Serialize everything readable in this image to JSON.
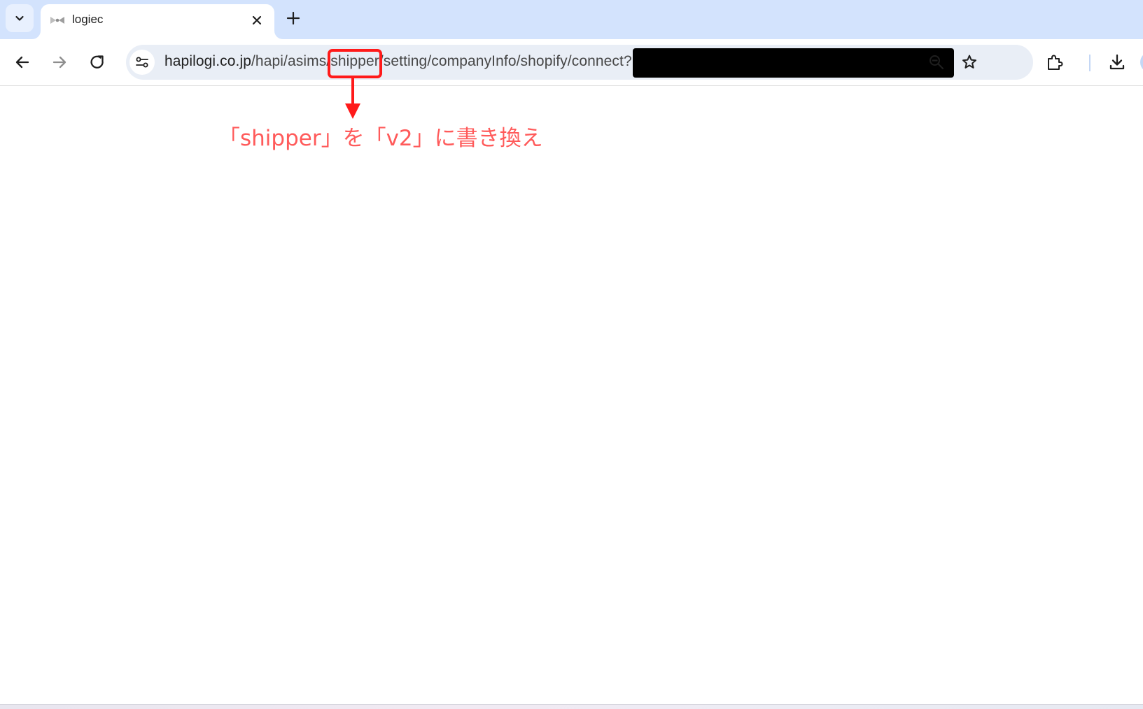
{
  "window": {
    "tab": {
      "title": "logiec",
      "icons": {
        "favicon": "bow-tie-favicon",
        "close": "close-icon"
      }
    },
    "tab_search_icon": "chevron-down-icon",
    "new_tab_icon": "plus-icon"
  },
  "toolbar": {
    "icons": [
      "back-arrow-icon",
      "forward-arrow-icon",
      "reload-icon",
      "zoom-out-icon",
      "star-icon",
      "extensions-icon",
      "download-icon"
    ],
    "url": {
      "host": "hapilogi.co.jp",
      "path_before": "/hapi/asims/",
      "highlighted_segment": "shipper",
      "path_after": "/setting/companyInfo/shopify/connect?"
    }
  },
  "annotation": {
    "text": "「shipper」を「v2」に書き換え",
    "color": "#ff5a5a",
    "box_color": "#ff1a1a"
  },
  "colors": {
    "tabstrip": "#d3e3fd",
    "omnibox": "#e9eef6"
  }
}
